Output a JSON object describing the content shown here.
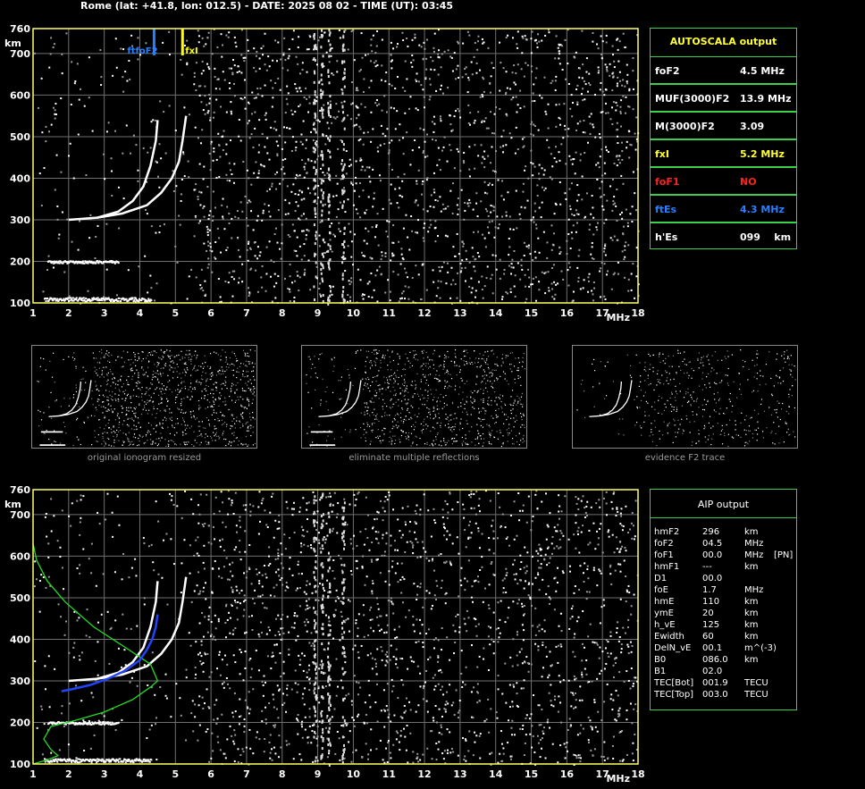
{
  "header": "Rome (lat: +41.8, lon: 012.5) - DATE: 2025 08 02 - TIME (UT): 03:45",
  "chart_data": [
    {
      "type": "scatter",
      "name": "ionogram-main",
      "title": "",
      "xlabel": "MHz",
      "ylabel": "km",
      "xlim": [
        1,
        18
      ],
      "ylim": [
        100,
        760
      ],
      "x_ticks": [
        1,
        2,
        3,
        4,
        5,
        6,
        7,
        8,
        9,
        10,
        11,
        12,
        13,
        14,
        15,
        16,
        17,
        18
      ],
      "y_ticks": [
        100,
        200,
        300,
        400,
        500,
        600,
        700,
        760
      ],
      "grid": true,
      "markers": [
        {
          "label": "ftfoF2",
          "x": 4.4,
          "color": "#2a7fff"
        },
        {
          "label": "fxI",
          "x": 5.2,
          "color": "#ffff00"
        }
      ],
      "traces": {
        "E_layer": {
          "x_range": [
            1.3,
            4.3
          ],
          "h": 110
        },
        "Es_layer": {
          "x_range": [
            1.4,
            3.4
          ],
          "h": 200
        },
        "F2_o": {
          "x": [
            2.0,
            2.8,
            3.4,
            3.8,
            4.1,
            4.3,
            4.45,
            4.5
          ],
          "h": [
            300,
            305,
            320,
            345,
            380,
            430,
            490,
            540
          ]
        },
        "F2_x": {
          "x": [
            2.8,
            3.5,
            4.2,
            4.6,
            4.9,
            5.1,
            5.2,
            5.3
          ],
          "h": [
            305,
            315,
            335,
            365,
            400,
            440,
            490,
            550
          ]
        }
      }
    },
    {
      "type": "scatter",
      "name": "ionogram-aip",
      "title": "",
      "xlabel": "MHz",
      "ylabel": "km",
      "xlim": [
        1,
        18
      ],
      "ylim": [
        100,
        760
      ],
      "x_ticks": [
        1,
        2,
        3,
        4,
        5,
        6,
        7,
        8,
        9,
        10,
        11,
        12,
        13,
        14,
        15,
        16,
        17,
        18
      ],
      "y_ticks": [
        100,
        200,
        300,
        400,
        500,
        600,
        700,
        760
      ],
      "grid": true,
      "profile_green": {
        "x": [
          1.0,
          1.4,
          1.7,
          1.5,
          1.3,
          1.5,
          2.2,
          3.0,
          3.8,
          4.3,
          4.5,
          4.3,
          3.6,
          2.7,
          1.9,
          1.4,
          1.1,
          1.0
        ],
        "h": [
          100,
          110,
          120,
          135,
          160,
          190,
          205,
          225,
          255,
          285,
          300,
          340,
          380,
          430,
          490,
          540,
          590,
          630
        ]
      },
      "profile_blue": {
        "x": [
          1.8,
          2.1,
          2.6,
          3.1,
          3.6,
          4.0,
          4.2,
          4.35,
          4.45,
          4.5
        ],
        "h": [
          275,
          280,
          290,
          305,
          325,
          350,
          375,
          400,
          430,
          460
        ]
      }
    }
  ],
  "autoscala": {
    "title": "AUTOSCALA output",
    "rows": [
      {
        "label": "foF2",
        "value": "4.5 MHz",
        "color": "#ffffff"
      },
      {
        "label": "MUF(3000)F2",
        "value": "13.9 MHz",
        "color": "#ffffff"
      },
      {
        "label": "M(3000)F2",
        "value": "3.09",
        "color": "#ffffff"
      },
      {
        "label": "fxI",
        "value": "5.2 MHz",
        "color": "#ffff33"
      },
      {
        "label": "foF1",
        "value": "NO",
        "color": "#ff2020"
      },
      {
        "label": "ftEs",
        "value": "4.3 MHz",
        "color": "#2a7fff"
      },
      {
        "label": "h'Es",
        "value": "099    km",
        "color": "#ffffff"
      }
    ]
  },
  "aip": {
    "title": "AIP output",
    "rows": [
      [
        "hmF2",
        "296",
        "km",
        ""
      ],
      [
        "foF2",
        "04.5",
        "MHz",
        ""
      ],
      [
        "foF1",
        "00.0",
        "MHz",
        "[PN]"
      ],
      [
        "hmF1",
        "---",
        "km",
        ""
      ],
      [
        "D1",
        "00.0",
        "",
        ""
      ],
      [
        "foE",
        "1.7",
        "MHz",
        ""
      ],
      [
        "hmE",
        "110",
        "km",
        ""
      ],
      [
        "ymE",
        "20",
        "km",
        ""
      ],
      [
        "h_vE",
        "125",
        "km",
        ""
      ],
      [
        "Ewidth",
        "60",
        "km",
        ""
      ],
      [
        "DelN_vE",
        "00.1",
        "m^(-3)",
        ""
      ],
      [
        "B0",
        "086.0",
        "km",
        ""
      ],
      [
        "B1",
        "02.0",
        "",
        ""
      ],
      [
        "TEC[Bot]",
        "001.9",
        "TECU",
        ""
      ],
      [
        "TEC[Top]",
        "003.0",
        "TECU",
        ""
      ]
    ]
  },
  "thumbnails": [
    {
      "caption": "original ionogram resized"
    },
    {
      "caption": "eliminate multiple reflections"
    },
    {
      "caption": "evidence F2 trace"
    }
  ],
  "colors": {
    "frame": "#ffff66",
    "grid": "#707070",
    "panel_border": "#3ad04a",
    "trace": "#ffffff",
    "green_profile": "#22dd22",
    "blue_profile": "#2244ff"
  }
}
